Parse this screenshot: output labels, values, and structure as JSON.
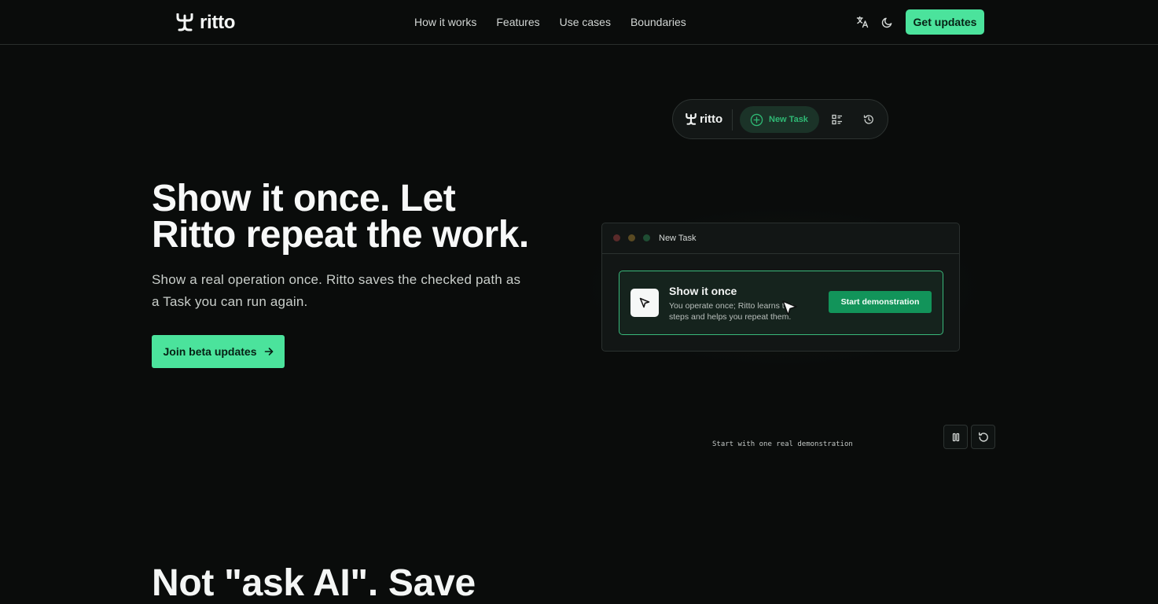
{
  "header": {
    "logo_text": "ritto",
    "nav": [
      {
        "label": "How it works"
      },
      {
        "label": "Features"
      },
      {
        "label": "Use cases"
      },
      {
        "label": "Boundaries"
      }
    ],
    "icons": [
      "translate-icon",
      "moon-icon"
    ],
    "cta_label": "Get updates"
  },
  "hero": {
    "title_line1": "Show it once. Let",
    "title_line2": "Ritto repeat the work.",
    "subtitle": "Show a real operation once. Ritto saves the checked path as a Task you can run again.",
    "cta_label": "Join beta updates"
  },
  "toolbar": {
    "logo_text": "ritto",
    "new_task_label": "New Task",
    "icons": [
      "task-list-icon",
      "history-icon"
    ]
  },
  "demo_window": {
    "title": "New Task",
    "card": {
      "title": "Show it once",
      "description": "You operate once; Ritto learns the steps and helps you repeat them.",
      "button_label": "Start demonstration"
    },
    "caption": "Start with one real demonstration",
    "controls": [
      "pause-icon",
      "replay-icon"
    ]
  },
  "next_section": {
    "title": "Not \"ask AI\". Save"
  },
  "colors": {
    "background": "#0a0c0b",
    "accent": "#4be39c",
    "accent_dark": "#12945a",
    "card_border": "#39b77a"
  }
}
